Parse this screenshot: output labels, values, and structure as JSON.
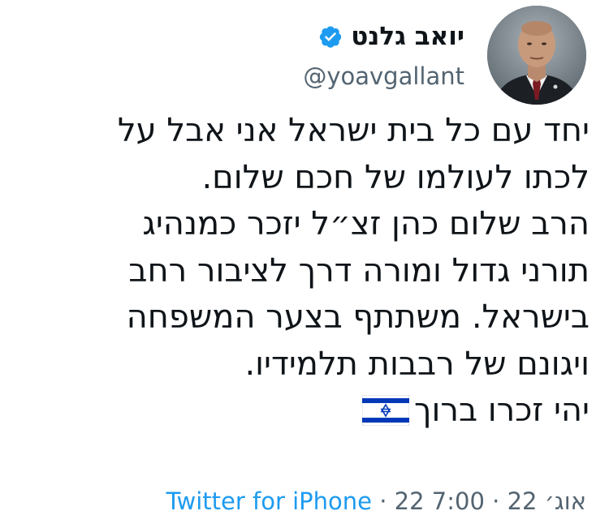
{
  "author": {
    "display_name": "יואב גלנט",
    "handle": "@yoavgallant",
    "verified": true,
    "verified_icon": "verified-badge-icon",
    "avatar_icon": "profile-photo"
  },
  "tweet": {
    "lines": [
      "יחד עם כל בית ישראל אני אבל על",
      "לכתו לעולמו של חכם שלום.",
      "הרב שלום כהן זצ״ל יזכר כמנהיג",
      "תורני גדול ומורה דרך לציבור רחב",
      "בישראל. משתתף בצער המשפחה",
      "ויגונם של רבבות תלמידיו.",
      "יהי זכרו ברוך"
    ],
    "emoji": "israel-flag-icon"
  },
  "meta": {
    "time": "7:00",
    "date": "22 אוג׳ 22",
    "separator": "·",
    "source": "Twitter for iPhone"
  },
  "colors": {
    "text": "#0f1419",
    "secondary": "#536471",
    "link": "#1d9bf0",
    "verified": "#1d9bf0",
    "flag_blue": "#0038b8"
  }
}
